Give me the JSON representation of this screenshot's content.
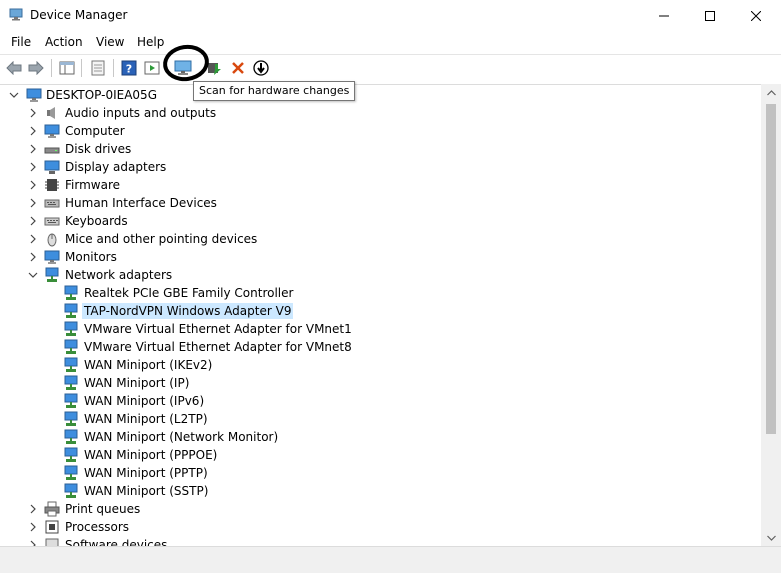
{
  "window": {
    "title": "Device Manager"
  },
  "menu": [
    "File",
    "Action",
    "View",
    "Help"
  ],
  "tooltip": "Scan for hardware changes",
  "tree": {
    "root": "DESKTOP-0IEA05G",
    "categories": [
      "Audio inputs and outputs",
      "Computer",
      "Disk drives",
      "Display adapters",
      "Firmware",
      "Human Interface Devices",
      "Keyboards",
      "Mice and other pointing devices",
      "Monitors",
      "Network adapters"
    ],
    "network_adapters": [
      "Realtek PCIe GBE Family Controller",
      "TAP-NordVPN Windows Adapter V9",
      "VMware Virtual Ethernet Adapter for VMnet1",
      "VMware Virtual Ethernet Adapter for VMnet8",
      "WAN Miniport (IKEv2)",
      "WAN Miniport (IP)",
      "WAN Miniport (IPv6)",
      "WAN Miniport (L2TP)",
      "WAN Miniport (Network Monitor)",
      "WAN Miniport (PPPOE)",
      "WAN Miniport (PPTP)",
      "WAN Miniport (SSTP)"
    ],
    "after_categories": [
      "Print queues",
      "Processors",
      "Software devices"
    ]
  },
  "colors": {
    "selection": "#cce8ff",
    "annotation": "#000000"
  }
}
